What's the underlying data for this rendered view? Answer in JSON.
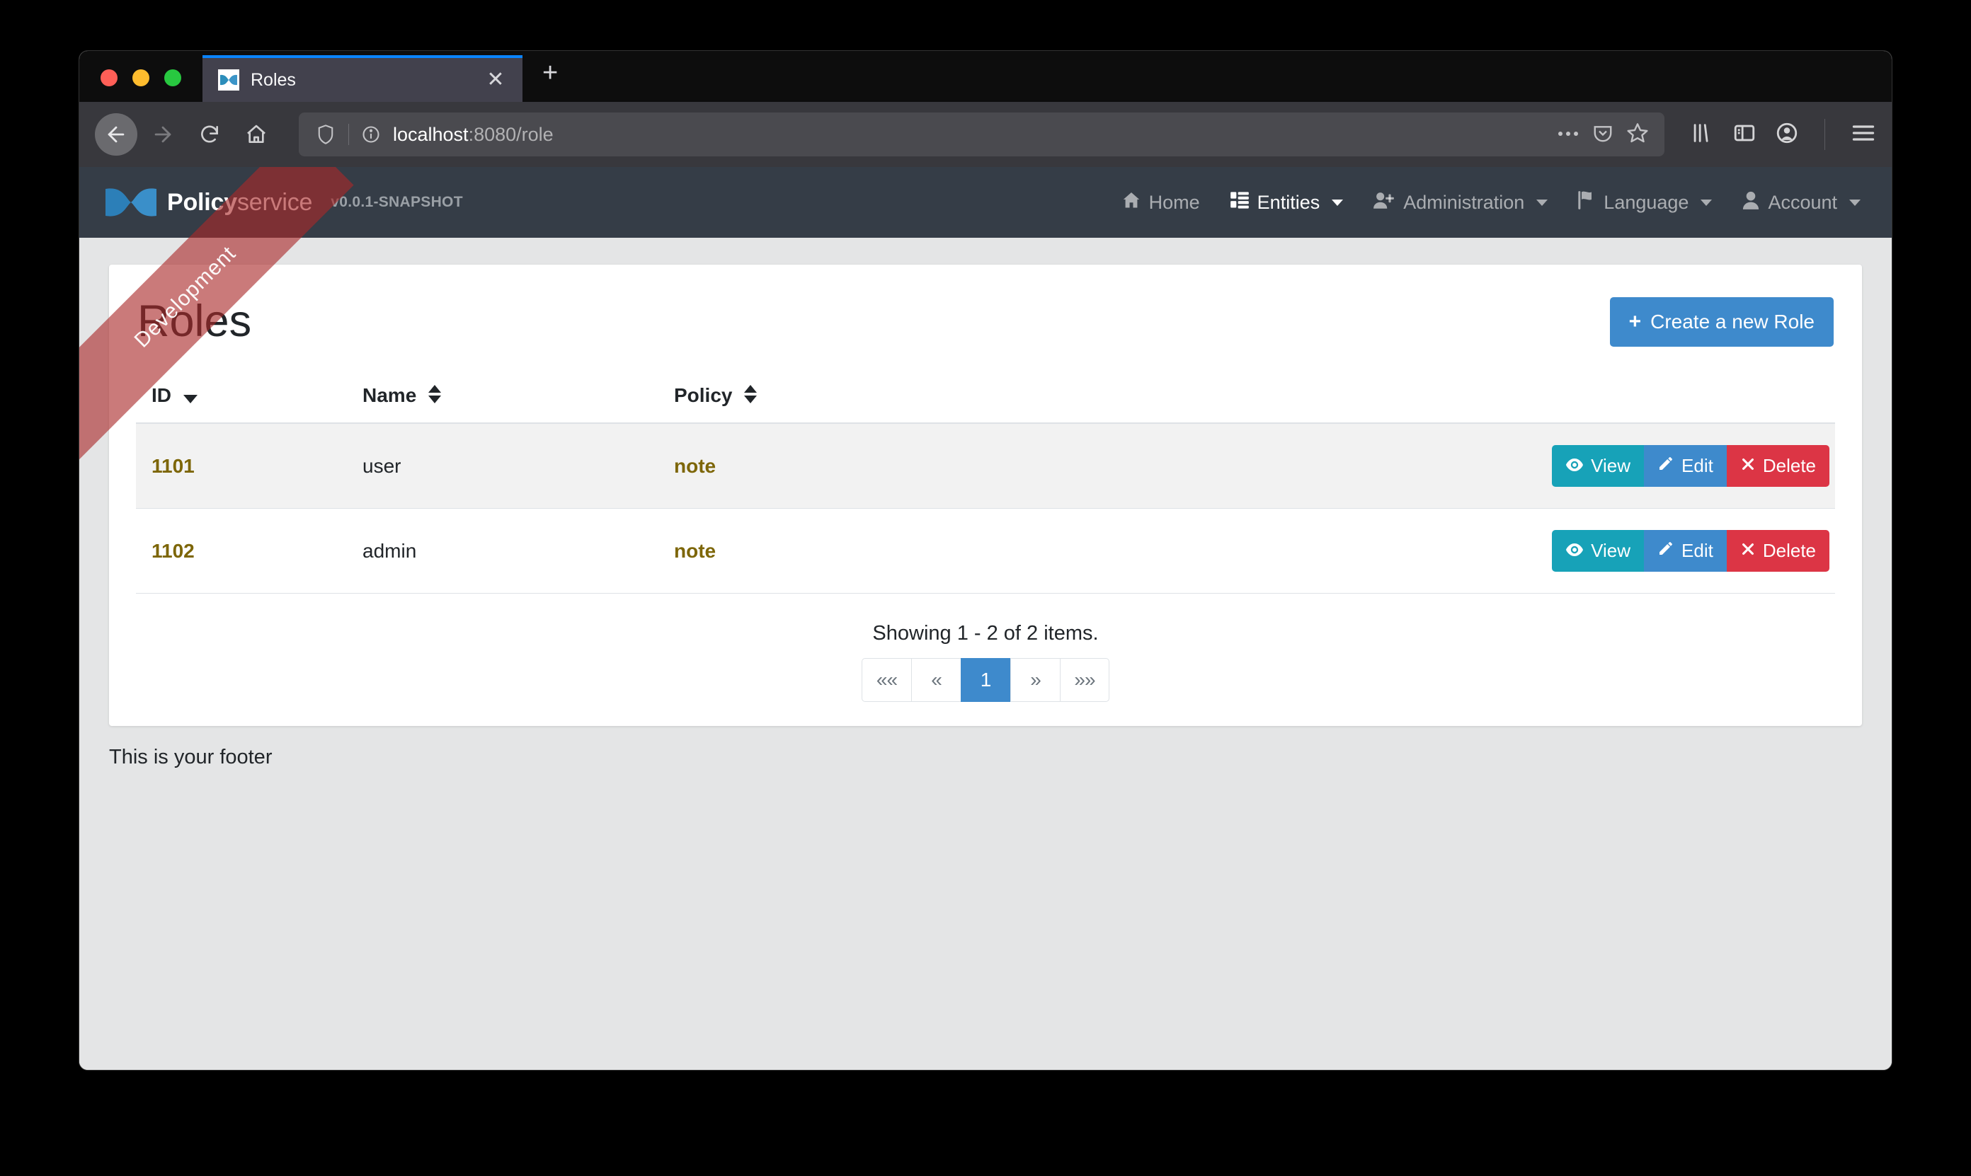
{
  "browser": {
    "tab": {
      "title": "Roles",
      "favicon": "jhipster-bowtie-icon",
      "close": "✕"
    },
    "newtab_label": "+",
    "toolbar": {
      "back": "←",
      "forward": "→",
      "reload": "⟳",
      "home": "⌂",
      "url_host": "localhost",
      "url_rest": ":8080/role",
      "page_actions": "⋯",
      "pocket": "pocket-icon",
      "bookmark": "star-icon",
      "library": "library-icon",
      "sidebar": "sidebar-icon",
      "account": "account-icon",
      "menu": "hamburger-menu-icon"
    }
  },
  "ribbon": {
    "text": "Development"
  },
  "app": {
    "brand": {
      "name_bold": "Policy",
      "name_light": "service",
      "version": "v0.0.1-SNAPSHOT"
    },
    "nav": [
      {
        "label": "Home",
        "icon": "home-icon",
        "active": false,
        "caret": false
      },
      {
        "label": "Entities",
        "icon": "list-icon",
        "active": true,
        "caret": true
      },
      {
        "label": "Administration",
        "icon": "user-plus-icon",
        "active": false,
        "caret": true
      },
      {
        "label": "Language",
        "icon": "flag-icon",
        "active": false,
        "caret": true
      },
      {
        "label": "Account",
        "icon": "user-icon",
        "active": false,
        "caret": true
      }
    ]
  },
  "main": {
    "title": "Roles",
    "create_button": {
      "label": "Create a new Role",
      "icon": "plus-icon"
    },
    "table": {
      "columns": [
        {
          "label": "ID",
          "sort": "desc"
        },
        {
          "label": "Name",
          "sort": "both"
        },
        {
          "label": "Policy",
          "sort": "both"
        },
        {
          "label": "",
          "sort": "none"
        }
      ],
      "rows": [
        {
          "id": "1101",
          "name": "user",
          "policy": "note"
        },
        {
          "id": "1102",
          "name": "admin",
          "policy": "note"
        }
      ],
      "row_actions": [
        {
          "label": "View",
          "icon": "eye-icon",
          "style": "info"
        },
        {
          "label": "Edit",
          "icon": "pencil-icon",
          "style": "primary"
        },
        {
          "label": "Delete",
          "icon": "times-icon",
          "style": "danger"
        }
      ]
    },
    "pagination": {
      "count_text": "Showing 1 - 2 of 2 items.",
      "items": [
        {
          "label": "««",
          "name": "first-page",
          "active": false
        },
        {
          "label": "«",
          "name": "previous-page",
          "active": false
        },
        {
          "label": "1",
          "name": "page-1",
          "active": true
        },
        {
          "label": "»",
          "name": "next-page",
          "active": false
        },
        {
          "label": "»»",
          "name": "last-page",
          "active": false
        }
      ]
    }
  },
  "footer": {
    "text": "This is your footer"
  },
  "colors": {
    "primary": "#3e8acc",
    "info": "#17a2b8",
    "danger": "#dc3545",
    "navbar": "#353d47",
    "link": "#7d6608"
  }
}
